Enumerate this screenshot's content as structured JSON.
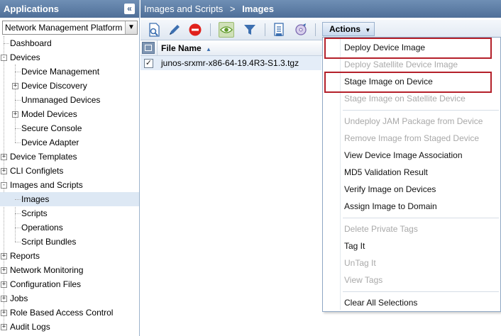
{
  "left_panel": {
    "title": "Applications",
    "collapse_icon": "double-chevron-left-icon",
    "platform_select": {
      "value": "Network Management Platform"
    },
    "tree": [
      {
        "label": "Dashboard",
        "level": 0,
        "expander": "none"
      },
      {
        "label": "Devices",
        "level": 0,
        "expander": "minus"
      },
      {
        "label": "Device Management",
        "level": 1,
        "expander": "none"
      },
      {
        "label": "Device Discovery",
        "level": 1,
        "expander": "plus"
      },
      {
        "label": "Unmanaged Devices",
        "level": 1,
        "expander": "none"
      },
      {
        "label": "Model Devices",
        "level": 1,
        "expander": "plus"
      },
      {
        "label": "Secure Console",
        "level": 1,
        "expander": "none"
      },
      {
        "label": "Device Adapter",
        "level": 1,
        "expander": "none"
      },
      {
        "label": "Device Templates",
        "level": 0,
        "expander": "plus"
      },
      {
        "label": "CLI Configlets",
        "level": 0,
        "expander": "plus"
      },
      {
        "label": "Images and Scripts",
        "level": 0,
        "expander": "minus"
      },
      {
        "label": "Images",
        "level": 1,
        "expander": "none",
        "selected": true
      },
      {
        "label": "Scripts",
        "level": 1,
        "expander": "none"
      },
      {
        "label": "Operations",
        "level": 1,
        "expander": "none"
      },
      {
        "label": "Script Bundles",
        "level": 1,
        "expander": "none"
      },
      {
        "label": "Reports",
        "level": 0,
        "expander": "plus"
      },
      {
        "label": "Network Monitoring",
        "level": 0,
        "expander": "plus"
      },
      {
        "label": "Configuration Files",
        "level": 0,
        "expander": "plus"
      },
      {
        "label": "Jobs",
        "level": 0,
        "expander": "plus"
      },
      {
        "label": "Role Based Access Control",
        "level": 0,
        "expander": "plus"
      },
      {
        "label": "Audit Logs",
        "level": 0,
        "expander": "plus"
      }
    ]
  },
  "breadcrumb": {
    "parent": "Images and Scripts",
    "separator": ">",
    "current": "Images"
  },
  "toolbar": {
    "icons": [
      "view-details-icon",
      "edit-pencil-icon",
      "delete-icon",
      "show-eye-icon",
      "filter-icon",
      "document-list-icon",
      "image-disc-icon"
    ],
    "actions_label": "Actions"
  },
  "grid": {
    "column": "File Name",
    "sort": "ascending",
    "rows": [
      {
        "checked": true,
        "name": "junos-srxmr-x86-64-19.4R3-S1.3.tgz"
      }
    ]
  },
  "actions_menu": {
    "groups": [
      [
        {
          "label": "Deploy Device Image",
          "enabled": true,
          "highlighted": true
        },
        {
          "label": "Deploy Satellite Device Image",
          "enabled": false
        },
        {
          "label": "Stage Image on Device",
          "enabled": true,
          "highlighted": true
        },
        {
          "label": "Stage Image on Satellite Device",
          "enabled": false
        }
      ],
      [
        {
          "label": "Undeploy JAM Package from Device",
          "enabled": false
        },
        {
          "label": "Remove Image from Staged Device",
          "enabled": false
        },
        {
          "label": "View Device Image Association",
          "enabled": true
        },
        {
          "label": "MD5 Validation Result",
          "enabled": true
        },
        {
          "label": "Verify Image on Devices",
          "enabled": true
        },
        {
          "label": "Assign Image to Domain",
          "enabled": true
        }
      ],
      [
        {
          "label": "Delete Private Tags",
          "enabled": false
        },
        {
          "label": "Tag It",
          "enabled": true
        },
        {
          "label": "UnTag It",
          "enabled": false
        },
        {
          "label": "View Tags",
          "enabled": false
        }
      ],
      [
        {
          "label": "Clear All Selections",
          "enabled": true
        }
      ]
    ]
  },
  "colors": {
    "header_blue": "#4f6f98",
    "selection_blue": "#dde8f4",
    "highlight_red": "#b4202a",
    "disabled_text": "#a9a9a9"
  }
}
